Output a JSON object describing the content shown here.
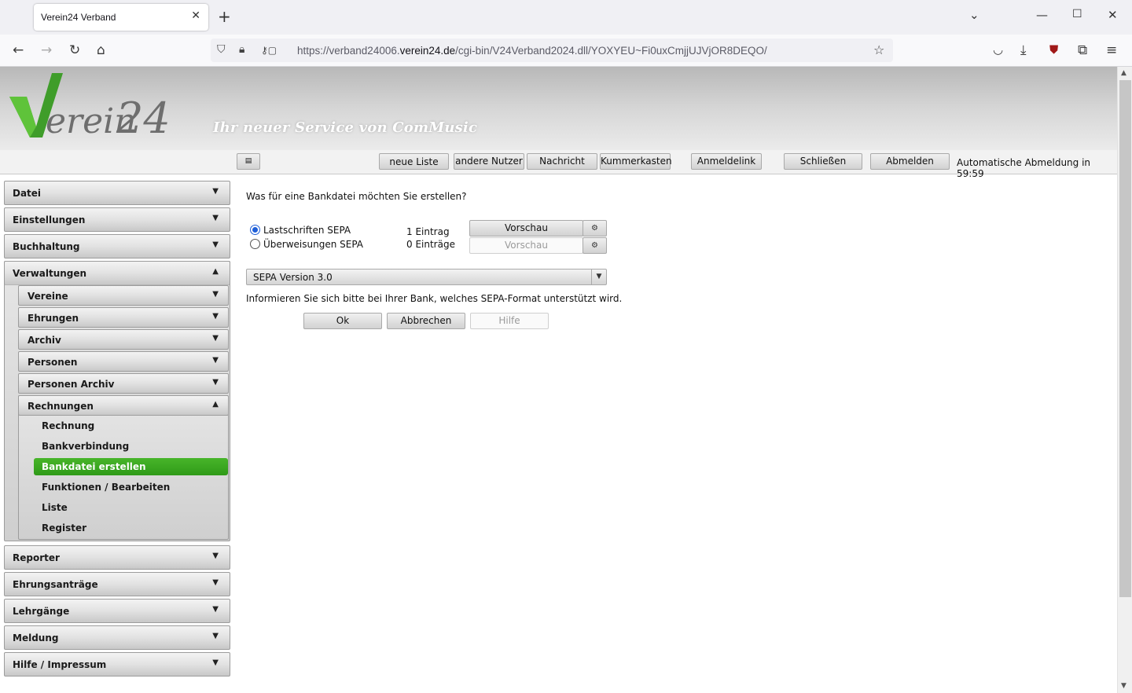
{
  "browser": {
    "tab_title": "Verein24 Verband",
    "url_prefix": "https://verband24006.",
    "url_domain": "verein24.de",
    "url_path": "/cgi-bin/V24Verband2024.dll/YOXYEU~Fi0uxCmjjUJVjOR8DEQO/"
  },
  "header": {
    "tagline": "Ihr neuer Service von ComMusic",
    "logo_text": "Verein 24"
  },
  "toolbar": {
    "buttons": [
      "neue Liste",
      "andere Nutzer",
      "Nachricht",
      "Kummerkasten",
      "Anmeldelink",
      "Schließen",
      "Abmelden"
    ],
    "auto_logout": "Automatische Abmeldung in 59:59"
  },
  "sidebar": {
    "top": [
      "Datei",
      "Einstellungen",
      "Buchhaltung",
      "Verwaltungen"
    ],
    "sub": [
      "Vereine",
      "Ehrungen",
      "Archiv",
      "Personen",
      "Personen Archiv",
      "Rechnungen"
    ],
    "leaves": [
      "Rechnung",
      "Bankverbindung",
      "Bankdatei erstellen",
      "Funktionen / Bearbeiten",
      "Liste",
      "Register"
    ],
    "bottom": [
      "Reporter",
      "Ehrungsanträge",
      "Lehrgänge",
      "Meldung",
      "Hilfe / Impressum"
    ]
  },
  "form": {
    "question": "Was für eine Bankdatei möchten Sie erstellen?",
    "option1_label": "Lastschriften SEPA",
    "option1_count": "1 Eintrag",
    "option2_label": "Überweisungen SEPA",
    "option2_count": "0 Einträge",
    "preview_label": "Vorschau",
    "version_select": "SEPA Version 3.0",
    "info": "Informieren Sie sich bitte bei Ihrer Bank, welches SEPA-Format unterstützt wird.",
    "ok": "Ok",
    "cancel": "Abbrechen",
    "help": "Hilfe"
  }
}
